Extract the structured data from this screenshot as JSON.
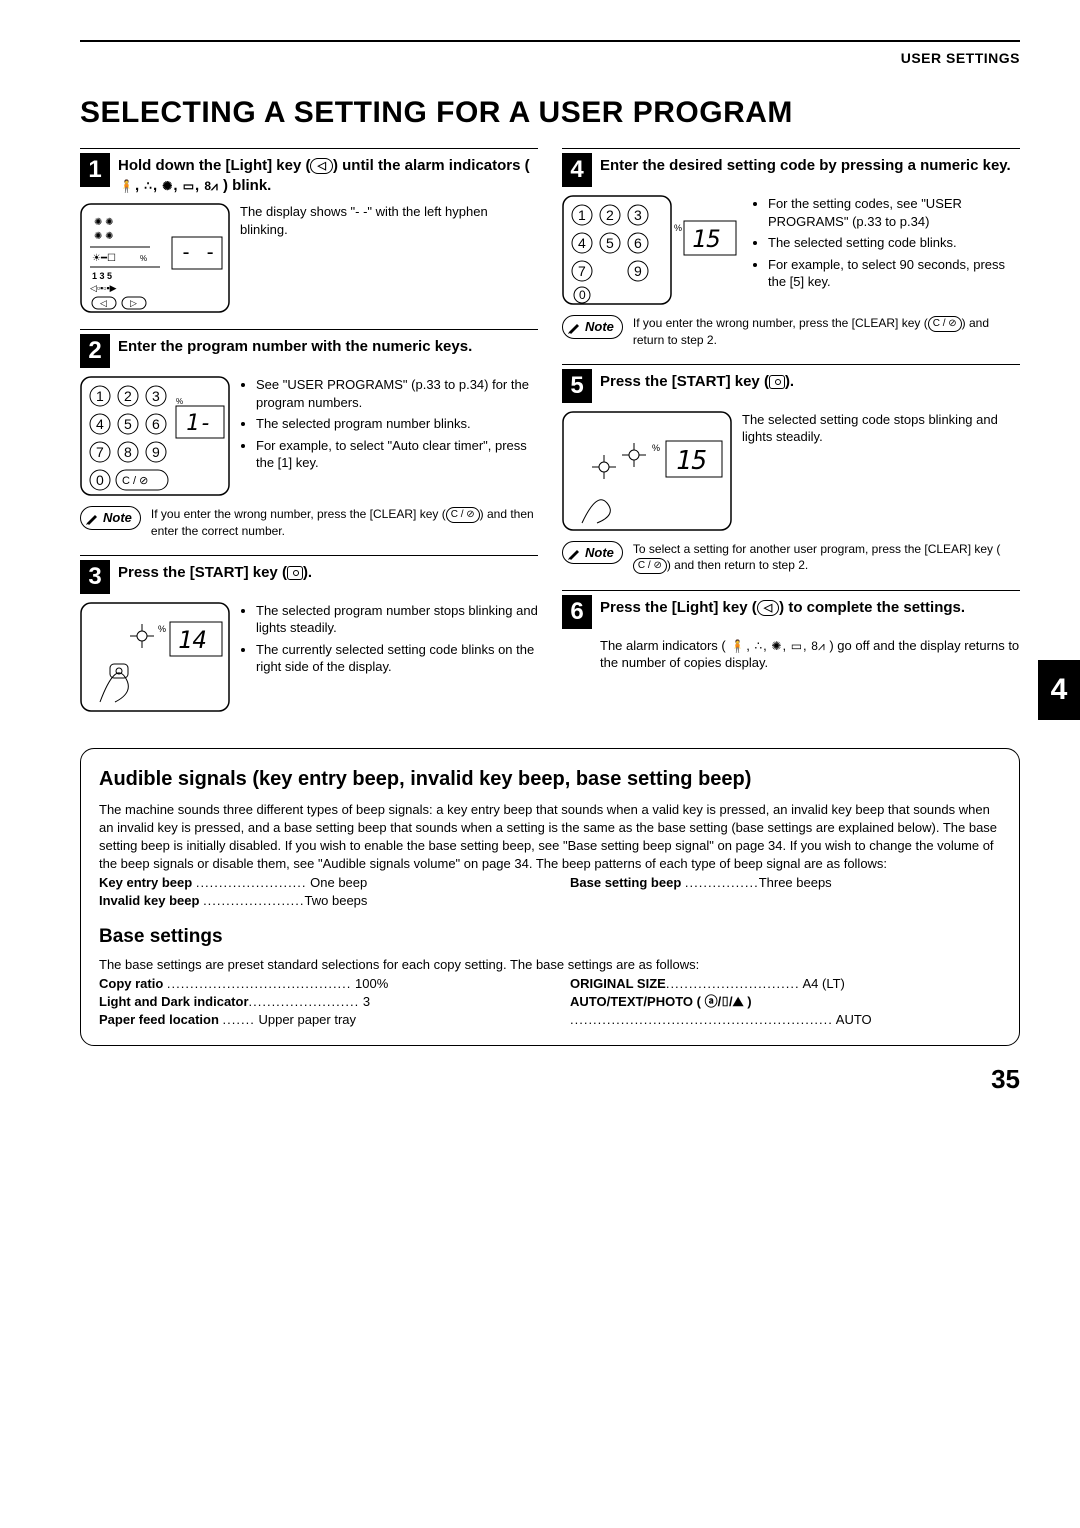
{
  "header": "USER SETTINGS",
  "title": "SELECTING A SETTING FOR A USER PROGRAM",
  "side_tab": "4",
  "page_number": "35",
  "steps": {
    "s1": {
      "num": "1",
      "title_pre": "Hold down the [Light] key (",
      "title_post": ") until the alarm indicators ( ",
      "title_end": ") blink.",
      "body": "The display shows \"- -\" with the left hyphen blinking."
    },
    "s2": {
      "num": "2",
      "title": "Enter the program number with the numeric keys.",
      "b1": "See \"USER PROGRAMS\" (p.33 to p.34) for the program numbers.",
      "b2": "The selected program number blinks.",
      "b3": "For example, to select \"Auto clear timer\", press the [1] key."
    },
    "s3": {
      "num": "3",
      "title_pre": "Press the [START] key (",
      "title_post": ").",
      "b1": "The selected program number stops blinking and lights steadily.",
      "b2": "The currently selected setting code blinks on the right side of the display."
    },
    "s4": {
      "num": "4",
      "title": "Enter the desired setting code by pressing a numeric key.",
      "b1": "For the setting codes, see \"USER PROGRAMS\" (p.33 to p.34)",
      "b2": "The selected setting code blinks.",
      "b3": "For example, to select 90 seconds, press the [5] key."
    },
    "s5": {
      "num": "5",
      "title_pre": "Press the [START] key (",
      "title_post": ").",
      "body": "The selected setting code stops blinking and lights steadily."
    },
    "s6": {
      "num": "6",
      "title_pre": "Press the [Light] key (",
      "title_post": ") to complete the settings.",
      "body_pre": "The alarm indicators ( ",
      "body_post": ") go off and the display returns to the number of copies display."
    }
  },
  "notes": {
    "n2": "If you enter the wrong number, press the [CLEAR] key (",
    "n2_end": ") and then enter the correct number.",
    "n4": "If you enter the wrong number, press the [CLEAR] key (",
    "n4_end": ") and return to step 2.",
    "n5": "To select a setting for another user program, press the [CLEAR] key (",
    "n5_end": ") and then return to step 2.",
    "note_label": "Note"
  },
  "audible": {
    "heading": "Audible signals (key entry beep, invalid key beep, base setting beep)",
    "para": "The machine sounds three different types of beep signals: a key entry beep that sounds when a valid key is pressed, an invalid key beep that sounds when an invalid key is pressed, and a base setting beep that sounds when a setting is the same as the base setting (base settings are explained below). The base setting beep is initially disabled. If you wish to enable the base setting beep, see \"Base setting beep signal\" on page 34. If you wish to change the volume of the beep signals or disable them, see \"Audible signals volume\" on page 34. The beep patterns of each type of beep signal are as follows:",
    "key_entry_label": "Key entry beep",
    "key_entry_val": "One beep",
    "invalid_label": "Invalid key beep",
    "invalid_val": "Two beeps",
    "base_label": "Base setting beep",
    "base_val": "Three beeps"
  },
  "base_settings": {
    "heading": "Base settings",
    "intro": "The base settings are preset standard selections for each copy setting. The base settings are as follows:",
    "copy_ratio_label": "Copy ratio",
    "copy_ratio_val": "100%",
    "light_dark_label": "Light and Dark indicator",
    "light_dark_val": "3",
    "paper_feed_label": "Paper feed location",
    "paper_feed_val": "Upper paper tray",
    "orig_size_label": "ORIGINAL SIZE",
    "orig_size_val": "A4 (LT)",
    "auto_label_pre": "AUTO/TEXT/PHOTO ( ",
    "auto_label_post": " )",
    "auto_val": "AUTO"
  },
  "icons": {
    "light_key": "◁",
    "start_key": "◦",
    "clear_key": "C / ⊘",
    "alarm1": "🧍",
    "alarm2": "∴",
    "alarm3": "✺",
    "alarm4": "▭",
    "alarm5": "8⩘",
    "auto1": "ⓐ",
    "auto2": "⌷",
    "auto3": "⛰"
  }
}
